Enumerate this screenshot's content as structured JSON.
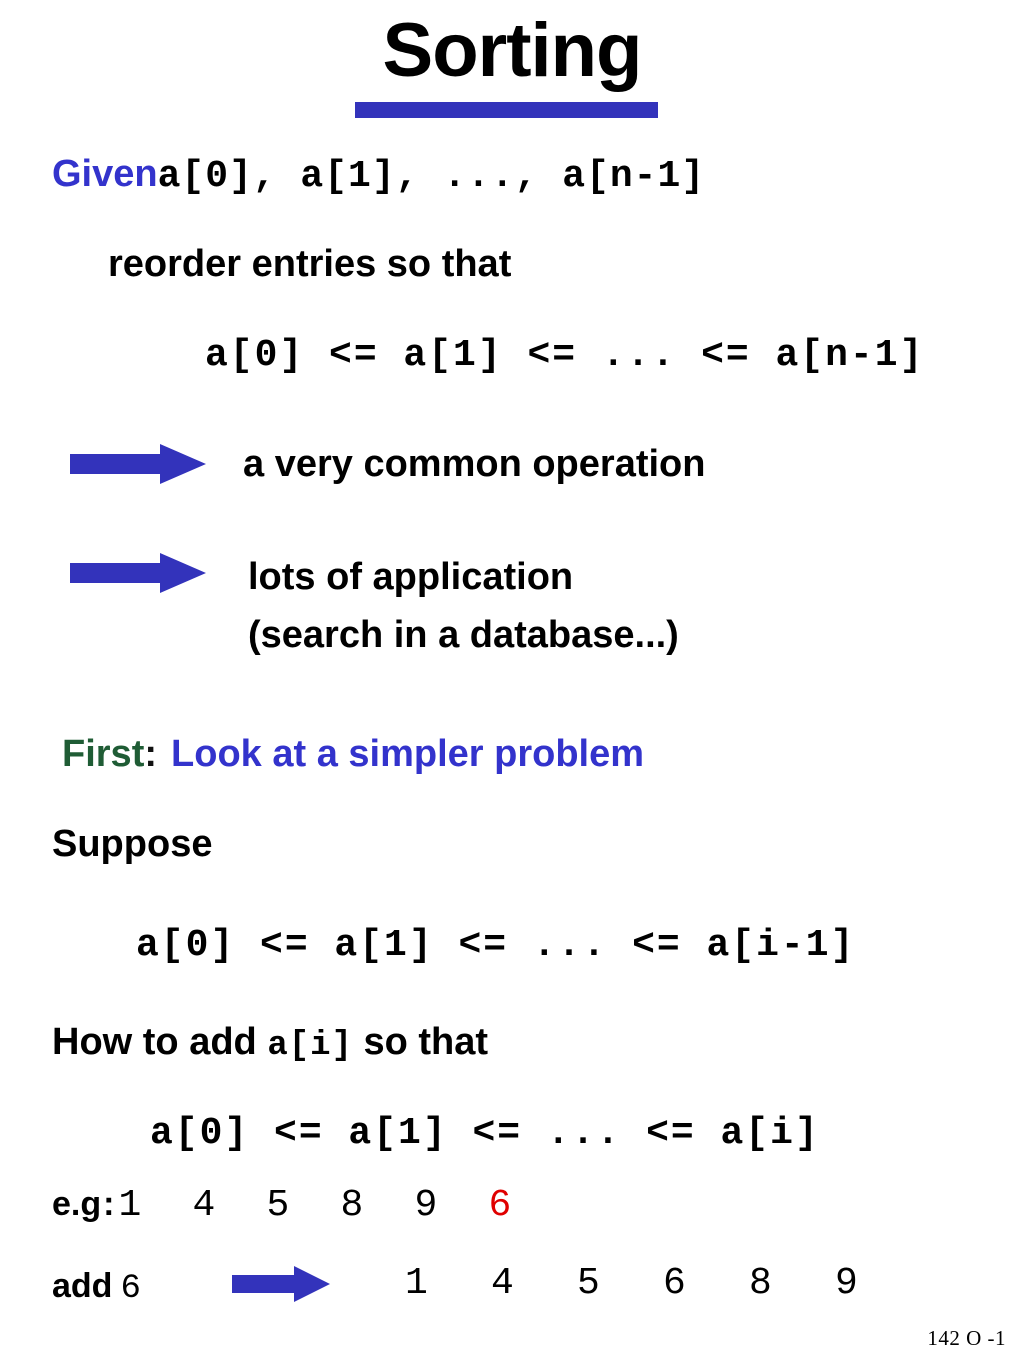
{
  "slide": {
    "title": "Sorting",
    "accent_color": "#3333bb",
    "blue_text_color": "#3333cc",
    "green_text_color": "#1f5c35",
    "highlight_color": "#e00000",
    "footer": "142 O -1"
  },
  "given": {
    "keyword": "Given",
    "code": "a[0], a[1], ..., a[n-1]"
  },
  "reorder": {
    "text": "reorder entries so that"
  },
  "chain1": {
    "code": "a[0] <= a[1] <= ... <= a[n-1]"
  },
  "bullets": [
    {
      "text": "a very common operation",
      "icon": "right-arrow"
    },
    {
      "line1": "lots of application",
      "line2": "(search in a database...)",
      "icon": "right-arrow"
    }
  ],
  "first": {
    "label": "First",
    "colon": ":",
    "text": "Look at a simpler problem"
  },
  "suppose": {
    "text": "Suppose"
  },
  "chain2": {
    "code": "a[0] <= a[1] <= ... <= a[i-1]"
  },
  "howto": {
    "prefix": "How to add ",
    "code": "a[i]",
    "suffix": " so that"
  },
  "chain3": {
    "code": "a[0] <= a[1] <= ... <= a[i]"
  },
  "example": {
    "label": "e.g",
    "colon": ":",
    "numbers": [
      "1",
      "4",
      "5",
      "8",
      "9"
    ],
    "inserted": "6"
  },
  "add": {
    "label": "add",
    "value": "6",
    "result": [
      "1",
      "4",
      "5",
      "6",
      "8",
      "9"
    ]
  }
}
